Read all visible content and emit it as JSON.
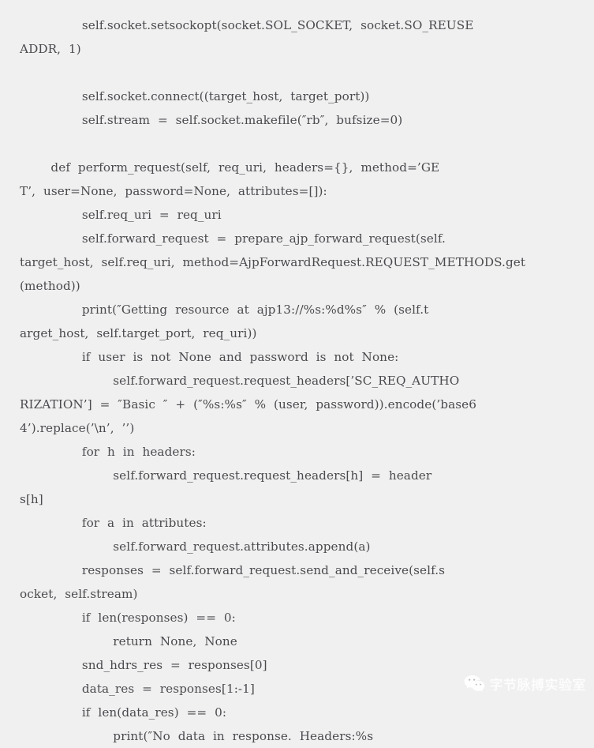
{
  "page": {
    "background_color": "#f0f0f0",
    "text_color": "#4a4a4f",
    "language": "python",
    "title": "AJP client code snippet"
  },
  "code": {
    "lines": [
      "                self.socket.setsockopt(socket.SOL_SOCKET,  socket.SO_REUSE",
      "ADDR,  1)",
      "",
      "                self.socket.connect((target_host,  target_port))",
      "                self.stream  =  self.socket.makefile(″rb″,  bufsize=0)",
      "",
      "        def  perform_request(self,  req_uri,  headers={},  method=’GE",
      "T’,  user=None,  password=None,  attributes=[]):",
      "                self.req_uri  =  req_uri",
      "                self.forward_request  =  prepare_ajp_forward_request(self.",
      "target_host,  self.req_uri,  method=AjpForwardRequest.REQUEST_METHODS.get",
      "(method))",
      "                print(″Getting  resource  at  ajp13://%s:%d%s″  %  (self.t",
      "arget_host,  self.target_port,  req_uri))",
      "                if  user  is  not  None  and  password  is  not  None:",
      "                        self.forward_request.request_headers[’SC_REQ_AUTHO",
      "RIZATION’]  =  ″Basic  ″  +  (″%s:%s″  %  (user,  password)).encode(’base6",
      "4’).replace(’\\n’,  ’’)",
      "                for  h  in  headers:",
      "                        self.forward_request.request_headers[h]  =  header",
      "s[h]",
      "                for  a  in  attributes:",
      "                        self.forward_request.attributes.append(a)",
      "                responses  =  self.forward_request.send_and_receive(self.s",
      "ocket,  self.stream)",
      "                if  len(responses)  ==  0:",
      "                        return  None,  None",
      "                snd_hdrs_res  =  responses[0]",
      "                data_res  =  responses[1:-1]",
      "                if  len(data_res)  ==  0:",
      "                        print(″No  data  in  response.  Headers:%s"
    ]
  },
  "watermark": {
    "icon": "wechat-icon",
    "label": "字节脉搏实验室",
    "color": "#ffffff"
  }
}
